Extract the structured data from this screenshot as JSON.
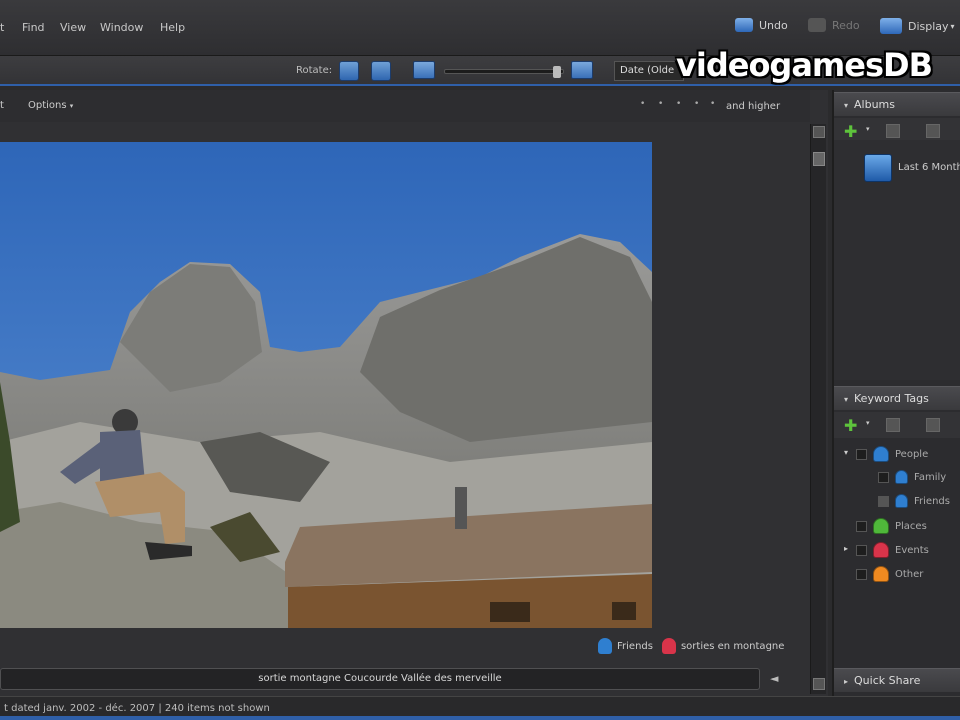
{
  "menubar": {
    "items": [
      "t",
      "Find",
      "View",
      "Window",
      "Help"
    ],
    "undo_label": "Undo",
    "redo_label": "Redo",
    "display_label": "Display",
    "display_arrow": "▾"
  },
  "toolbar": {
    "rotate_label": "Rotate:",
    "sort_value": "Date (Olde"
  },
  "watermark": "videogamesDB",
  "main": {
    "left_label": "t",
    "options_label": "Options",
    "options_arrow": "▾",
    "stars": [
      "•",
      "•",
      "•",
      "•",
      "•"
    ],
    "rating_label": "and higher",
    "photo_tags": [
      {
        "label": "Friends",
        "color": "#2f7fd0"
      },
      {
        "label": "sorties en montagne",
        "color": "#d8344a"
      }
    ],
    "caption": "sortie montagne Coucourde Vallée des merveille",
    "send_icon": "◄"
  },
  "albums": {
    "title": "Albums",
    "collapse_icon": "▾",
    "plus_icon": "✚",
    "plus_arrow": "▾",
    "items": [
      {
        "label": "Last 6 Month"
      }
    ]
  },
  "keyword_tags": {
    "title": "Keyword Tags",
    "collapse_icon": "▾",
    "plus_icon": "✚",
    "plus_arrow": "▾",
    "items": [
      {
        "label": "People",
        "color": "#2f7fd0",
        "expander": "▾"
      },
      {
        "label": "Family",
        "color": "#2f7fd0",
        "expander": ""
      },
      {
        "label": "Friends",
        "color": "#2f7fd0",
        "expander": ""
      },
      {
        "label": "Places",
        "color": "#4fb83a",
        "expander": ""
      },
      {
        "label": "Events",
        "color": "#d8344a",
        "expander": "▸"
      },
      {
        "label": "Other",
        "color": "#f08a20",
        "expander": ""
      }
    ]
  },
  "quick_share": {
    "title": "Quick Share",
    "expand_icon": "▸"
  },
  "statusbar": {
    "text": "t dated janv. 2002 - déc. 2007  |  240 items not shown"
  },
  "colors": {
    "accent": "#2f5fa8",
    "sky": "#3f71be"
  }
}
